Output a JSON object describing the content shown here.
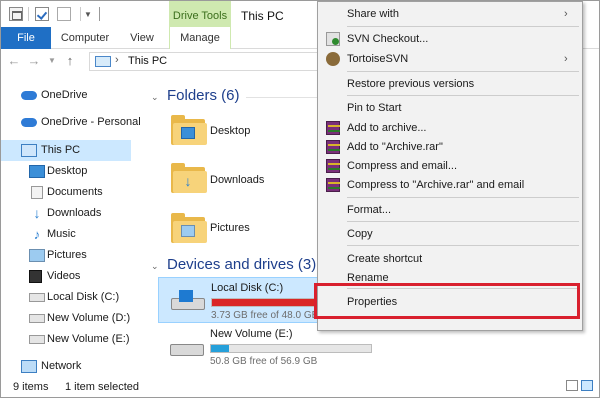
{
  "titlebar": {
    "contextual_tab": "Drive Tools",
    "title": "This PC"
  },
  "ribbon": {
    "tabs": [
      "File",
      "Computer",
      "View",
      "Manage"
    ]
  },
  "address": {
    "path": "This PC"
  },
  "sidebar": {
    "items": [
      {
        "label": "OneDrive",
        "icon": "cloud-icon"
      },
      {
        "label": "OneDrive - Personal",
        "icon": "cloud-icon"
      },
      {
        "label": "This PC",
        "icon": "computer-icon",
        "selected": true
      },
      {
        "label": "Desktop",
        "icon": "desktop-icon"
      },
      {
        "label": "Documents",
        "icon": "documents-icon"
      },
      {
        "label": "Downloads",
        "icon": "download-icon"
      },
      {
        "label": "Music",
        "icon": "music-icon"
      },
      {
        "label": "Pictures",
        "icon": "pictures-icon"
      },
      {
        "label": "Videos",
        "icon": "videos-icon"
      },
      {
        "label": "Local Disk (C:)",
        "icon": "drive-icon"
      },
      {
        "label": "New Volume (D:)",
        "icon": "drive-icon"
      },
      {
        "label": "New Volume (E:)",
        "icon": "drive-icon"
      },
      {
        "label": "Network",
        "icon": "network-icon"
      }
    ]
  },
  "main": {
    "folders_header": "Folders (6)",
    "folders": [
      "Desktop",
      "Downloads",
      "Pictures"
    ],
    "drives_header": "Devices and drives (3)",
    "drives": [
      {
        "name": "Local Disk (C:)",
        "free": "3.73 GB free of 48.0 GB",
        "used_fraction": 0.92,
        "bar_color": "#da2626",
        "selected": true
      },
      {
        "name": "New Volume (E:)",
        "free": "50.8 GB free of 56.9 GB",
        "used_fraction": 0.11,
        "bar_color": "#26a0da",
        "selected": false
      }
    ]
  },
  "status": {
    "items": "9 items",
    "selected": "1 item selected"
  },
  "context_menu": {
    "items": [
      {
        "label": "Share with",
        "submenu": true
      },
      {
        "label": "SVN Checkout...",
        "icon": "svn-checkout-icon"
      },
      {
        "label": "TortoiseSVN",
        "icon": "tortoisesvn-icon",
        "submenu": true
      },
      {
        "label": "Restore previous versions"
      },
      {
        "label": "Pin to Start"
      },
      {
        "label": "Add to archive...",
        "icon": "winrar-icon"
      },
      {
        "label": "Add to \"Archive.rar\"",
        "icon": "winrar-icon"
      },
      {
        "label": "Compress and email...",
        "icon": "winrar-icon"
      },
      {
        "label": "Compress to \"Archive.rar\" and email",
        "icon": "winrar-icon"
      },
      {
        "label": "Format..."
      },
      {
        "label": "Copy"
      },
      {
        "label": "Create shortcut"
      },
      {
        "label": "Rename"
      },
      {
        "label": "Properties",
        "highlighted": true
      }
    ],
    "highlight_color": "#d9202e"
  }
}
